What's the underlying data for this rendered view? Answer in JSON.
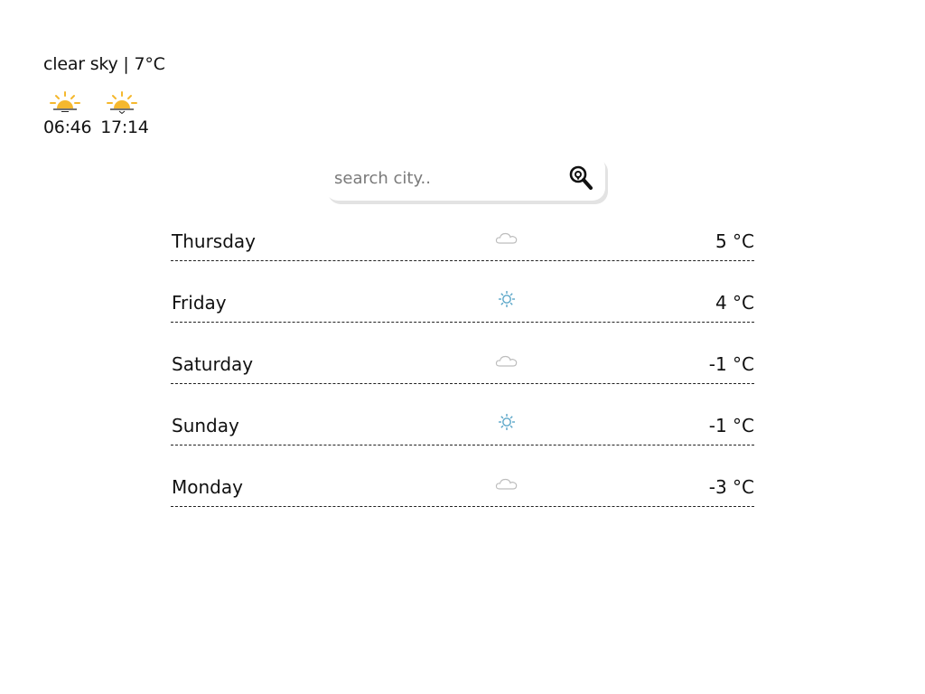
{
  "current": {
    "summary": "clear sky | 7°C",
    "sunrise": {
      "time": "06:46",
      "icon": "sunrise-icon"
    },
    "sunset": {
      "time": "17:14",
      "icon": "sunset-icon"
    },
    "sun_color": "#f5b82e"
  },
  "search": {
    "placeholder": "search city..",
    "value": "",
    "icon": "search-location-icon"
  },
  "forecast": [
    {
      "day": "Thursday",
      "icon": "cloud-icon",
      "temp": "5 °C"
    },
    {
      "day": "Friday",
      "icon": "sun-icon",
      "temp": "4 °C"
    },
    {
      "day": "Saturday",
      "icon": "cloud-icon",
      "temp": "-1 °C"
    },
    {
      "day": "Sunday",
      "icon": "sun-icon",
      "temp": "-1 °C"
    },
    {
      "day": "Monday",
      "icon": "cloud-icon",
      "temp": "-3 °C"
    }
  ],
  "colors": {
    "cloud": "#bdbdbd",
    "sun_small": "#5aa6c8"
  }
}
